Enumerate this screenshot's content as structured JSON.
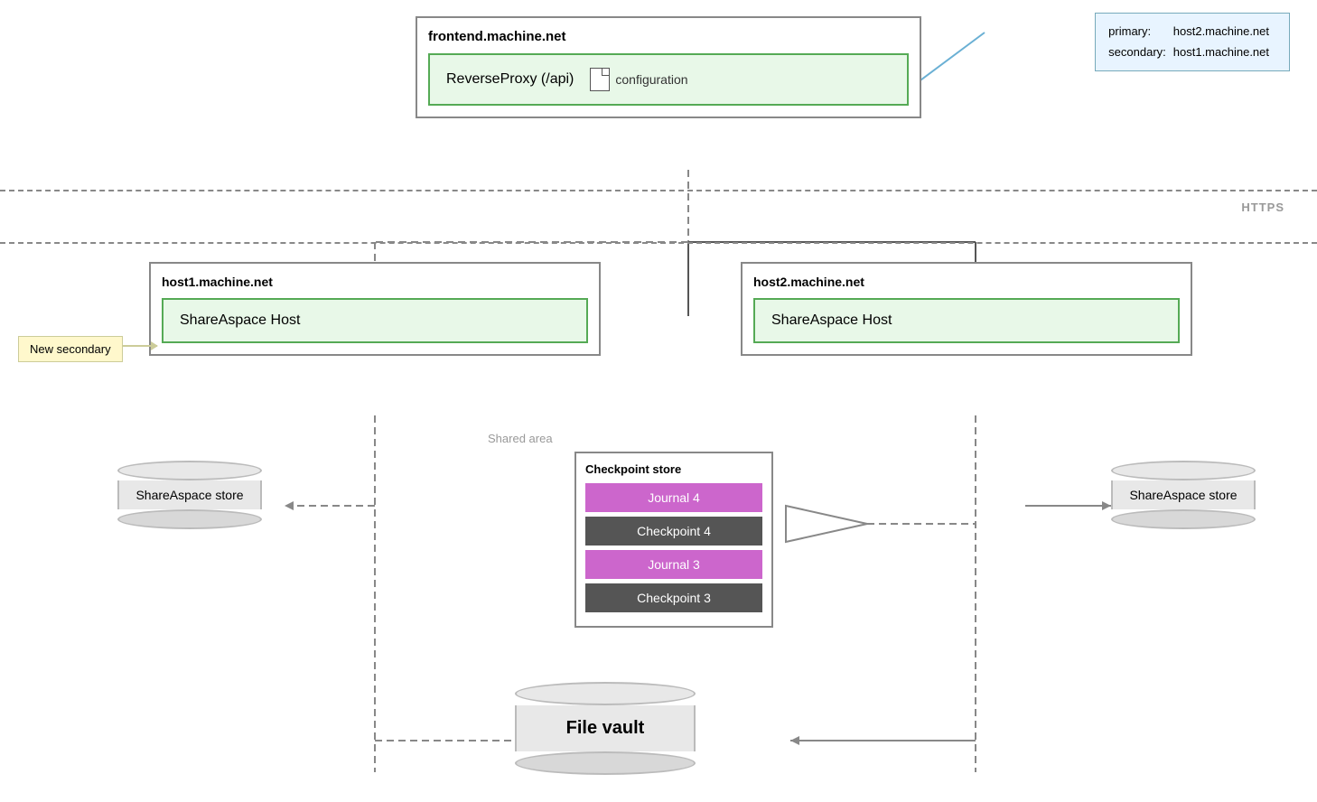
{
  "frontend": {
    "title": "frontend.machine.net",
    "reverseProxy": "ReverseProxy (/api)",
    "config": "configuration"
  },
  "infoBox": {
    "primary_label": "primary:",
    "primary_value": "host2.machine.net",
    "secondary_label": "secondary:",
    "secondary_value": "host1.machine.net"
  },
  "httpsLabel": "HTTPS",
  "hosts": {
    "left": {
      "title": "host1.machine.net",
      "service": "ShareAspace Host"
    },
    "right": {
      "title": "host2.machine.net",
      "service": "ShareAspace Host"
    }
  },
  "newSecondaryLabel": "New secondary",
  "sharedAreaLabel": "Shared area",
  "checkpointStore": {
    "title": "Checkpoint store",
    "items": [
      {
        "label": "Journal 4",
        "type": "journal"
      },
      {
        "label": "Checkpoint 4",
        "type": "checkpoint"
      },
      {
        "label": "Journal 3",
        "type": "journal"
      },
      {
        "label": "Checkpoint 3",
        "type": "checkpoint"
      }
    ]
  },
  "dbLeft": "ShareAspace store",
  "dbRight": "ShareAspace store",
  "fileVault": "File vault"
}
